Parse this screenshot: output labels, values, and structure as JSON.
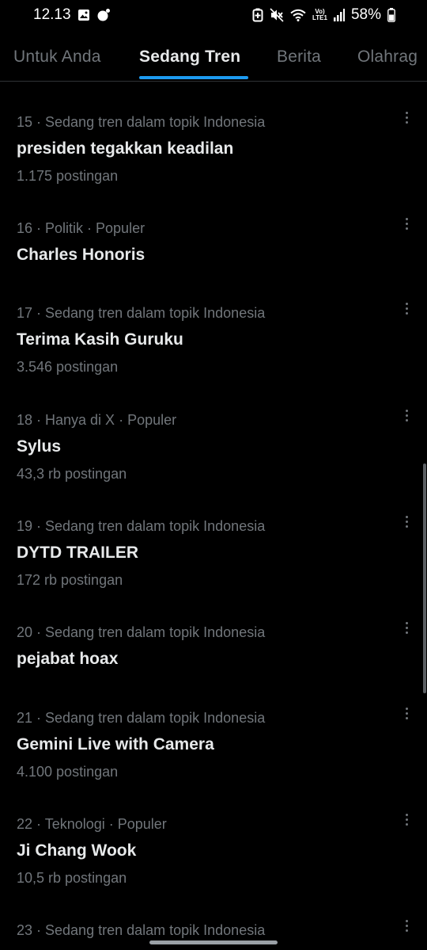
{
  "status_bar": {
    "time": "12.13",
    "battery": "58%",
    "volte_top": "Vo)",
    "volte_bottom": "LTE1",
    "icons": [
      "gallery-icon",
      "notification-dot-icon",
      "battery-saver-icon",
      "mute-icon",
      "wifi-icon",
      "signal-icon",
      "battery-icon"
    ]
  },
  "tabs": [
    {
      "label": "Untuk Anda",
      "active": false
    },
    {
      "label": "Sedang Tren",
      "active": true
    },
    {
      "label": "Berita",
      "active": false
    },
    {
      "label": "Olahrag",
      "active": false
    }
  ],
  "colors": {
    "background": "#000000",
    "accent": "#1d9bf0",
    "text_primary": "#e7e9ea",
    "text_secondary": "#71767b"
  },
  "trends": [
    {
      "meta": "15 · Sedang tren dalam topik Indonesia",
      "title": "presiden tegakkan keadilan",
      "count": "1.175 postingan"
    },
    {
      "meta": "16 · Politik · Populer",
      "title": "Charles Honoris",
      "count": ""
    },
    {
      "meta": "17 · Sedang tren dalam topik Indonesia",
      "title": "Terima Kasih Guruku",
      "count": "3.546 postingan"
    },
    {
      "meta": "18 · Hanya di X · Populer",
      "title": "Sylus",
      "count": "43,3 rb postingan"
    },
    {
      "meta": "19 · Sedang tren dalam topik Indonesia",
      "title": "DYTD TRAILER",
      "count": "172 rb postingan"
    },
    {
      "meta": "20 · Sedang tren dalam topik Indonesia",
      "title": "pejabat hoax",
      "count": ""
    },
    {
      "meta": "21 · Sedang tren dalam topik Indonesia",
      "title": "Gemini Live with Camera",
      "count": "4.100 postingan"
    },
    {
      "meta": "22 · Teknologi · Populer",
      "title": "Ji Chang Wook",
      "count": "10,5 rb postingan"
    },
    {
      "meta": "23 · Sedang tren dalam topik Indonesia",
      "title": "",
      "count": ""
    }
  ]
}
